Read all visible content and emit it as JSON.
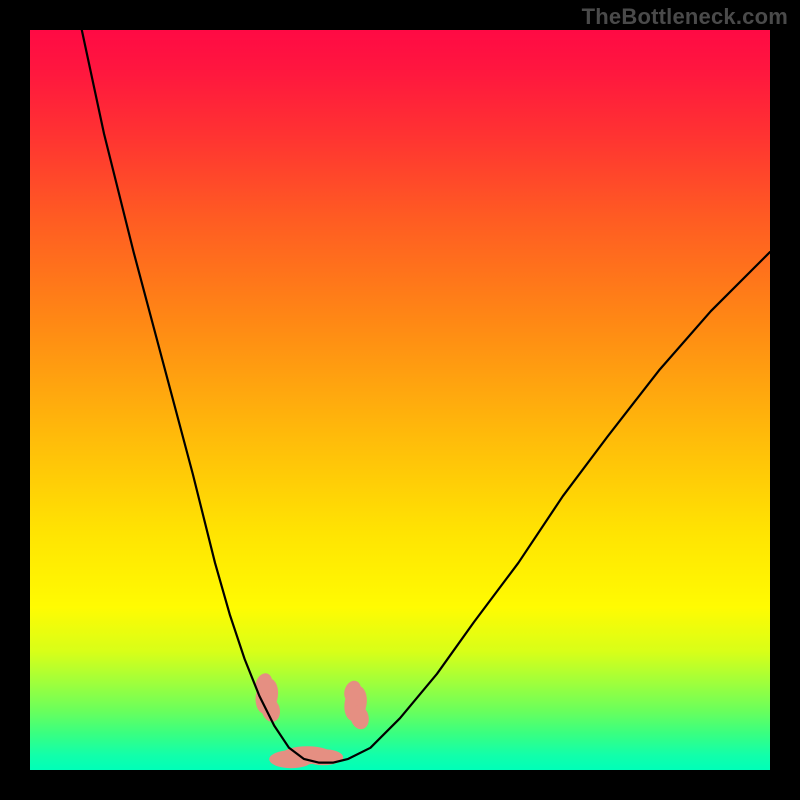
{
  "watermark": "TheBottleneck.com",
  "chart_data": {
    "type": "line",
    "title": "",
    "xlabel": "",
    "ylabel": "",
    "xlim": [
      0,
      100
    ],
    "ylim": [
      0,
      100
    ],
    "series": [
      {
        "name": "bottleneck-curve",
        "x": [
          7,
          10,
          14,
          18,
          22,
          25,
          27,
          29,
          31,
          33,
          35,
          37,
          39,
          41,
          43,
          46,
          50,
          55,
          60,
          66,
          72,
          78,
          85,
          92,
          100
        ],
        "y": [
          100,
          86,
          70,
          55,
          40,
          28,
          21,
          15,
          10,
          6,
          3,
          1.5,
          1,
          1,
          1.5,
          3,
          7,
          13,
          20,
          28,
          37,
          45,
          54,
          62,
          70
        ]
      }
    ],
    "markers": [
      {
        "name": "left-pink-blob",
        "x": 32,
        "y": 10,
        "color": "#e58f82"
      },
      {
        "name": "right-pink-blob",
        "x": 44,
        "y": 9,
        "color": "#e58f82"
      },
      {
        "name": "bottom-pink-blob",
        "x": 38,
        "y": 2,
        "color": "#e58f82"
      }
    ],
    "background_gradient": {
      "top": "#ff0a44",
      "mid": "#ffe402",
      "bottom": "#00ffb8"
    }
  }
}
